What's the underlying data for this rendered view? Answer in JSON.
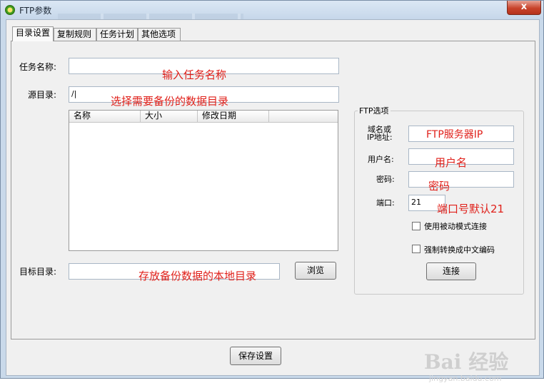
{
  "window": {
    "title": "FTP参数",
    "close_label": "x"
  },
  "tabs": [
    {
      "label": "目录设置"
    },
    {
      "label": "复制规则"
    },
    {
      "label": "任务计划"
    },
    {
      "label": "其他选项"
    }
  ],
  "form": {
    "task_name_label": "任务名称:",
    "task_name_value": "",
    "task_name_hint": "输入任务名称",
    "source_dir_label": "源目录:",
    "source_dir_value": "/|",
    "source_dir_hint": "选择需要备份的数据目录",
    "target_dir_label": "目标目录:",
    "target_dir_value": "",
    "target_dir_hint": "存放备份数据的本地目录",
    "browse_label": "浏览"
  },
  "file_list": {
    "columns": [
      "名称",
      "大小",
      "修改日期"
    ],
    "rows": []
  },
  "ftp": {
    "group_title": "FTP选项",
    "domain_label_line1": "域名或",
    "domain_label_line2": "IP地址:",
    "domain_hint": "FTP服务器IP",
    "user_label": "用户名:",
    "user_hint": "用户名",
    "password_label": "密码:",
    "password_hint": "密码",
    "port_label": "端口:",
    "port_value": "21",
    "port_hint": "端口号默认21",
    "passive_label": "使用被动模式连接",
    "passive_checked": false,
    "force_chinese_label": "强制转换成中文编码",
    "force_chinese_checked": false,
    "connect_label": "连接"
  },
  "footer": {
    "save_label": "保存设置"
  },
  "watermark": {
    "text": "Bai 经验",
    "sub": "jingyan.baidu.com"
  }
}
